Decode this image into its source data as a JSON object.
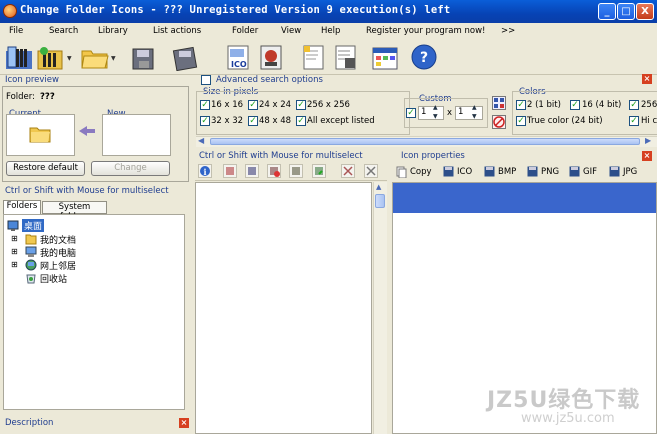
{
  "window": {
    "title": "Change Folder Icons - ??? Unregistered Version 9 execution(s) left",
    "min_glyph": "_",
    "max_glyph": "□",
    "close_glyph": "X"
  },
  "menu": {
    "items": [
      "File",
      "Search",
      "Library",
      "List actions",
      "Folder",
      "View",
      "Help",
      "Register your program now!"
    ],
    "overflow": ">>"
  },
  "icon_preview": {
    "title": "Icon preview",
    "folder_label": "Folder:",
    "folder_value": "???",
    "current_label": "Current",
    "new_label": "New",
    "restore_button": "Restore default",
    "change_button": "Change"
  },
  "multiselect_hint": "Ctrl or Shift with Mouse for multiselect",
  "folder_tabs": [
    "Folders",
    "System folders"
  ],
  "tree": [
    {
      "label": "桌面",
      "selected": true
    },
    {
      "label": "我的文档"
    },
    {
      "label": "我的电脑"
    },
    {
      "label": "网上邻居"
    },
    {
      "label": "回收站"
    }
  ],
  "description_title": "Description",
  "search": {
    "advanced_label": "Advanced search options",
    "size_title": "Size in pixels",
    "sizes": [
      "16 x 16",
      "24 x 24",
      "256 x 256",
      "32 x 32",
      "48 x 48",
      "All except listed"
    ],
    "custom_title": "Custom",
    "custom_w": "1",
    "custom_x": "x",
    "custom_h": "1",
    "colors_title": "Colors",
    "colors": [
      "2 (1 bit)",
      "16 (4 bit)",
      "256",
      "True color (24 bit)",
      "Hi c"
    ]
  },
  "list_panel_title": "Ctrl or Shift with Mouse for multiselect",
  "icon_properties": {
    "title": "Icon properties",
    "copy_label": "Copy",
    "formats": [
      "ICO",
      "BMP",
      "PNG",
      "GIF",
      "JPG"
    ]
  },
  "watermark": {
    "line1": "JZ5U绿色下载",
    "line2": "www.jz5u.com"
  }
}
